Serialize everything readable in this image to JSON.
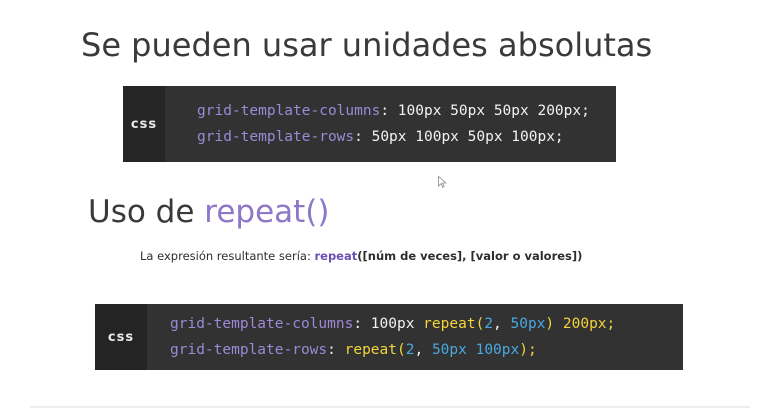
{
  "slide": {
    "title_main": "Se pueden usar unidades absolutas",
    "code_block_1": {
      "lang": "css",
      "line1": {
        "prop": "grid-template-columns",
        "rest": ": 100px 50px 50px 200px;"
      },
      "line2": {
        "prop": "grid-template-rows",
        "rest": ": 50px 100px 50px 100px;"
      }
    },
    "title_sub": {
      "prefix": "Uso de ",
      "accent": "repeat()"
    },
    "explain": {
      "prefix": "La expresión resultante sería: ",
      "keyword": "repeat",
      "args": "([núm de veces], [valor o valores])"
    },
    "code_block_2": {
      "lang": "css",
      "line1": {
        "prop": "grid-template-columns",
        "t1": ": 100px ",
        "fn": "repeat",
        "t2": "(",
        "n1": "2",
        "t3": ", ",
        "n2": "50px",
        "t4": ") 200px;"
      },
      "line2": {
        "prop": "grid-template-rows",
        "t1": ": ",
        "fn": "repeat",
        "t2": "(",
        "n1": "2",
        "t3": ", ",
        "n2": "50px 100px",
        "t4": ");"
      }
    },
    "colors": {
      "property": "#9b8ad6",
      "function": "#f2d53c",
      "number": "#4aa8e0",
      "accent": "#8c77c9",
      "code_bg": "#323232"
    },
    "icons": {
      "cursor": "mouse-pointer-icon"
    }
  }
}
